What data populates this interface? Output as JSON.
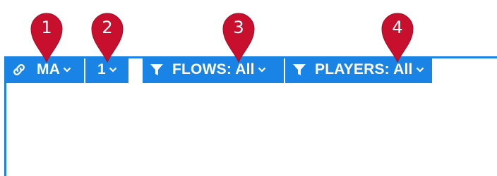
{
  "toolbar": {
    "link_label": "MA",
    "number_label": "1",
    "flows_label": "FLOWS: All",
    "players_label": "PLAYERS: All"
  },
  "markers": [
    "1",
    "2",
    "3",
    "4"
  ],
  "icons": {
    "link": "link-icon",
    "filter": "filter-icon",
    "chevron": "chevron-down-icon"
  },
  "colors": {
    "toolbar": "#1a83e6",
    "marker": "#c8102e",
    "text": "#ffffff"
  }
}
